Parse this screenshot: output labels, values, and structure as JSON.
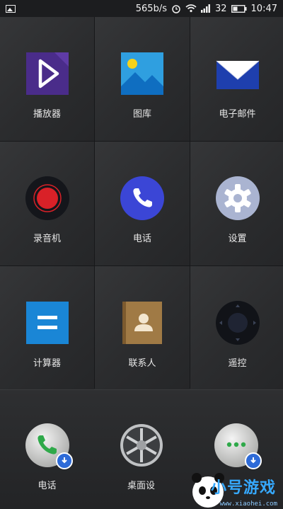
{
  "status_bar": {
    "net_speed": "565b/s",
    "signal": "32",
    "time": "10:47",
    "icons": [
      "image-notification-icon",
      "alarm-icon",
      "wifi-icon",
      "signal-icon",
      "battery-icon"
    ]
  },
  "apps": [
    {
      "label": "播放器",
      "icon": "video-player-icon"
    },
    {
      "label": "图库",
      "icon": "gallery-icon"
    },
    {
      "label": "电子邮件",
      "icon": "email-icon"
    },
    {
      "label": "录音机",
      "icon": "recorder-icon"
    },
    {
      "label": "电话",
      "icon": "phone-icon"
    },
    {
      "label": "设置",
      "icon": "settings-gear-icon"
    },
    {
      "label": "计算器",
      "icon": "calculator-icon"
    },
    {
      "label": "联系人",
      "icon": "contacts-icon"
    },
    {
      "label": "遥控",
      "icon": "remote-control-icon"
    }
  ],
  "dock": [
    {
      "label": "电话",
      "icon": "phone-dock-icon",
      "badge": "download-badge-icon"
    },
    {
      "label": "桌面设",
      "icon": "desktop-settings-icon"
    },
    {
      "label": "",
      "icon": "messages-icon",
      "badge": "download-badge-icon"
    }
  ],
  "watermark": {
    "title": "小号游戏",
    "url": "www.xiaohei.com"
  },
  "colors": {
    "background": "#2a2b2d",
    "player": "#4a2c8a",
    "gallery": "#2f9fe0",
    "email": "#1e3fae",
    "recorder_red": "#d92128",
    "phone_blue": "#3b46d6",
    "settings_grey": "#aab4d1",
    "calculator_blue": "#1a86d6",
    "contacts_brown": "#a07a45",
    "remote_dark": "#1f2433"
  }
}
